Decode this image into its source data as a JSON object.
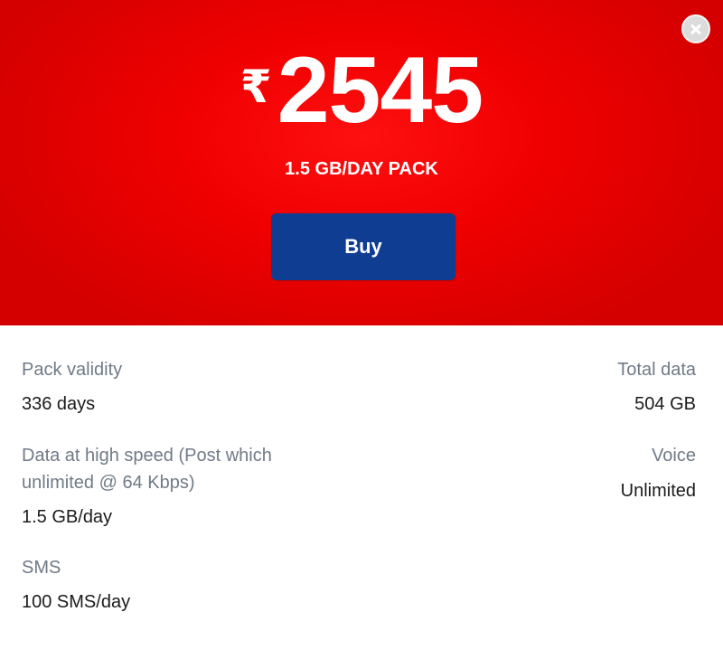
{
  "offer": {
    "currency_symbol": "₹",
    "price": "2545",
    "pack_name": "1.5 GB/DAY PACK",
    "buy_label": "Buy"
  },
  "details": {
    "pack_validity": {
      "label": "Pack validity",
      "value": "336 days"
    },
    "total_data": {
      "label": "Total data",
      "value": "504 GB"
    },
    "high_speed_data": {
      "label_line1": "Data at high speed (Post which",
      "label_line2": "unlimited @ 64 Kbps)",
      "value": "1.5 GB/day"
    },
    "voice": {
      "label": "Voice",
      "value": "Unlimited"
    },
    "sms": {
      "label": "SMS",
      "value": "100 SMS/day"
    }
  },
  "icons": {
    "close": "close-icon"
  },
  "colors": {
    "hero_red": "#f00000",
    "buy_blue": "#0f3d91",
    "label_gray": "#707a86"
  }
}
